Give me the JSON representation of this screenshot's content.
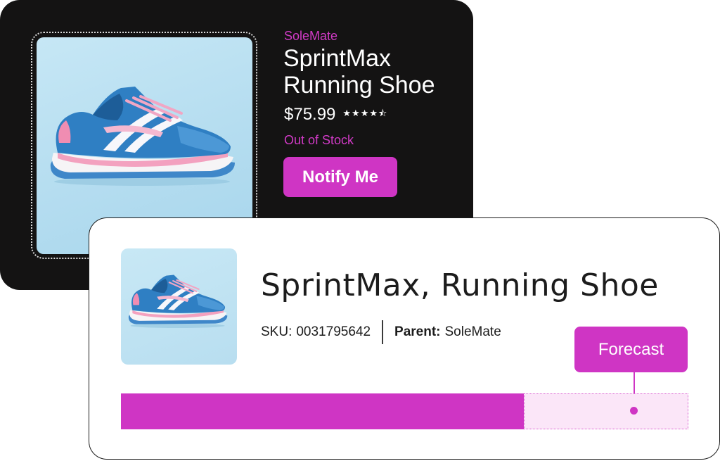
{
  "colors": {
    "accent": "#cf35c4",
    "dark_card": "#141313",
    "forecast_area": "#fbe6f8",
    "image_background": "#b5ddf0"
  },
  "product_card": {
    "brand": "SoleMate",
    "title": "SprintMax Running Shoe",
    "price": "$75.99",
    "rating": 4.5,
    "rating_stars_text": "★★★★⯪",
    "stock_status": "Out of Stock",
    "notify_button_label": "Notify Me",
    "image_icon": "running-shoe"
  },
  "forecast_card": {
    "title": "SprintMax, Running Shoe",
    "sku_label": "SKU:",
    "sku_value": "0031795642",
    "parent_label": "Parent:",
    "parent_value": "SoleMate",
    "forecast_button_label": "Forecast",
    "thumbnail_icon": "running-shoe",
    "stock_bar": {
      "current_fraction": 0.71,
      "forecast_fraction": 0.29
    }
  }
}
